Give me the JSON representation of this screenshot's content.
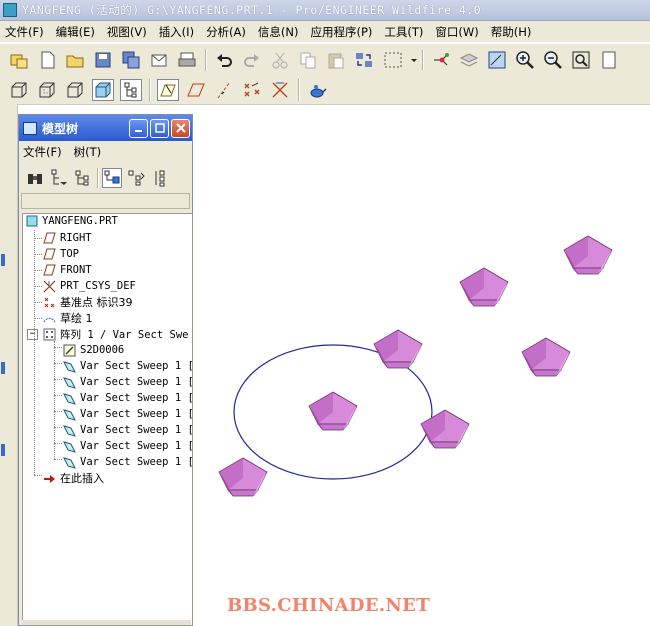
{
  "window": {
    "title": "YANGFENG (活动的) G:\\YANGFENG.PRT.1 - Pro/ENGINEER Wildfire 4.0"
  },
  "menubar": [
    "文件(F)",
    "编辑(E)",
    "视图(V)",
    "插入(I)",
    "分析(A)",
    "信息(N)",
    "应用程序(P)",
    "工具(T)",
    "窗口(W)",
    "帮助(H)"
  ],
  "model_tree": {
    "title": "模型树",
    "menu": [
      "文件(F)",
      "树(T)"
    ],
    "items": [
      {
        "label": "YANGFENG.PRT",
        "icon": "part-icon"
      },
      {
        "label": "RIGHT",
        "icon": "datum-plane-icon"
      },
      {
        "label": "TOP",
        "icon": "datum-plane-icon"
      },
      {
        "label": "FRONT",
        "icon": "datum-plane-icon"
      },
      {
        "label": "PRT_CSYS_DEF",
        "icon": "csys-icon"
      },
      {
        "label": "基准点 标识39",
        "icon": "datum-point-icon"
      },
      {
        "label": "草绘 1",
        "icon": "sketch-icon"
      },
      {
        "label": "阵列 1 / Var Sect Swe",
        "icon": "pattern-icon"
      },
      {
        "label": "S2D0006",
        "icon": "sketch-edit-icon"
      },
      {
        "label": "Var Sect Sweep 1 [",
        "icon": "sweep-icon"
      },
      {
        "label": "Var Sect Sweep 1 [",
        "icon": "sweep-icon"
      },
      {
        "label": "Var Sect Sweep 1 [",
        "icon": "sweep-icon"
      },
      {
        "label": "Var Sect Sweep 1 [",
        "icon": "sweep-icon"
      },
      {
        "label": "Var Sect Sweep 1 [",
        "icon": "sweep-icon"
      },
      {
        "label": "Var Sect Sweep 1 [",
        "icon": "sweep-icon"
      },
      {
        "label": "Var Sect Sweep 1 [",
        "icon": "sweep-icon"
      },
      {
        "label": "在此插入",
        "icon": "insert-here-arrow-icon"
      }
    ]
  },
  "watermark": "BBS.CHINADE.NET",
  "colors": {
    "titlebar": "#b6c1dc",
    "panel_title": "#2a59d0",
    "feature_pink": "#d27ad8",
    "circle": "#1e2a9a",
    "watermark": "#f0836a"
  }
}
